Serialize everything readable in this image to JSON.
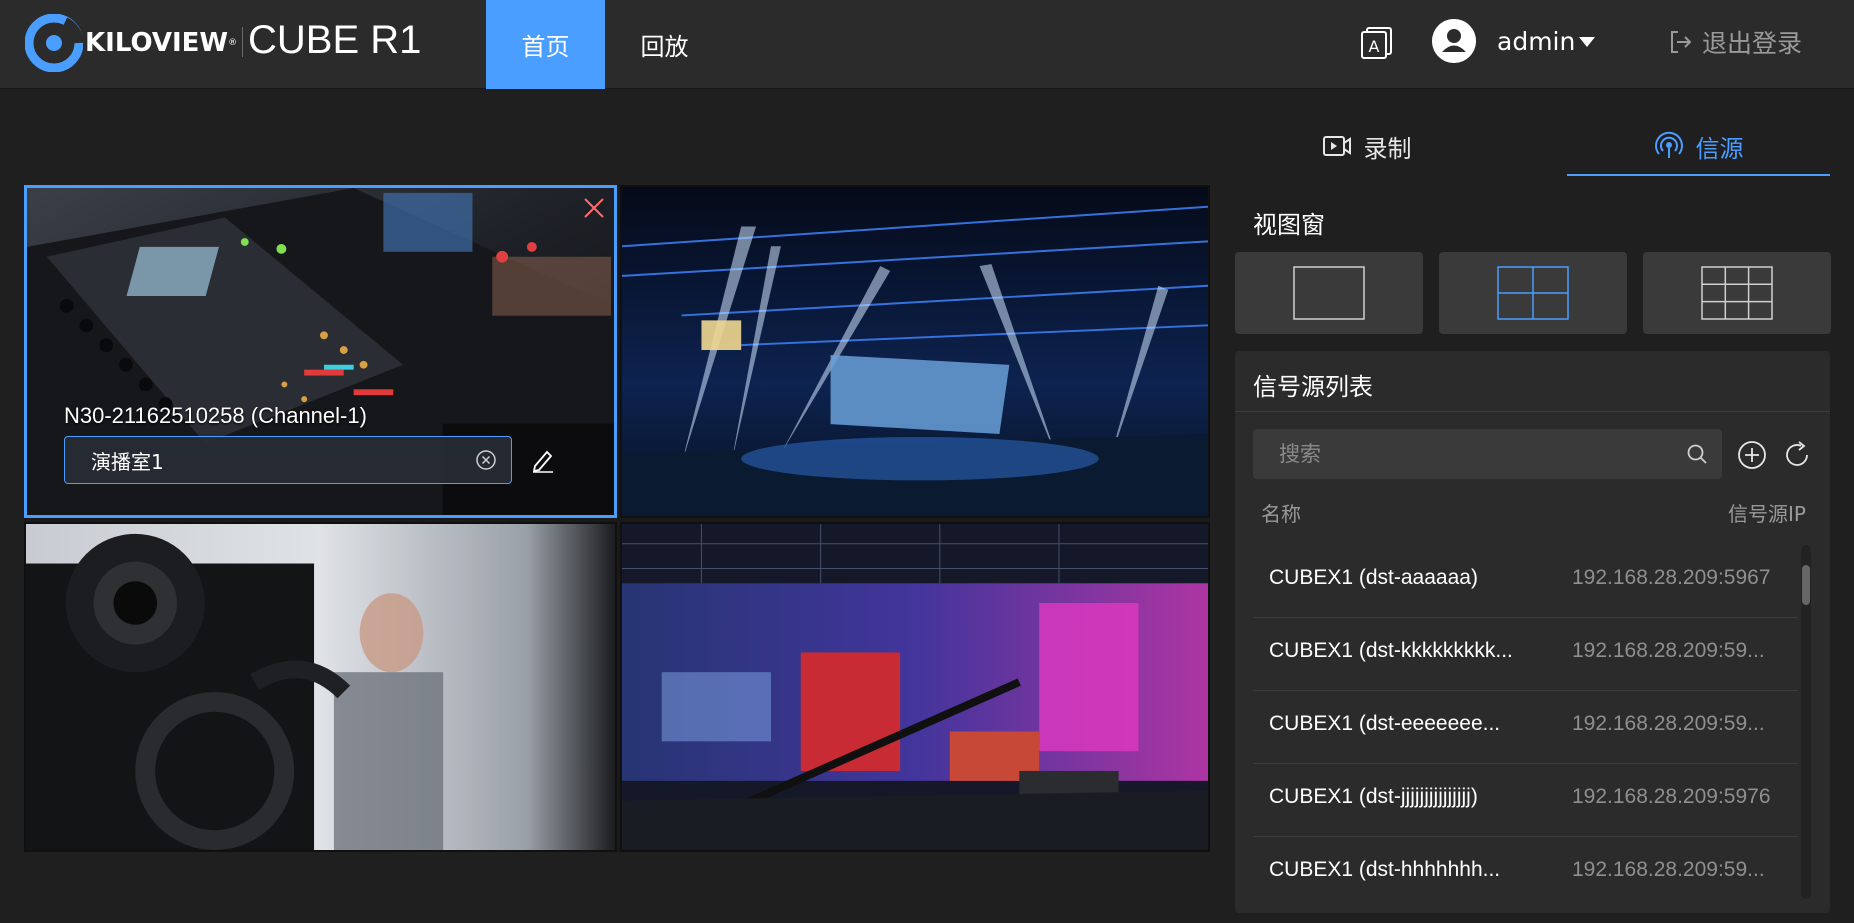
{
  "header": {
    "logo_text": "KILOVIEW",
    "logo_reg": "®",
    "product_name": "CUBE R1",
    "nav": [
      {
        "label": "首页",
        "active": true
      },
      {
        "label": "回放",
        "active": false
      }
    ],
    "language_icon": "A",
    "user": {
      "name": "admin"
    },
    "logout_label": "退出登录"
  },
  "colors": {
    "accent": "#4a9eff",
    "topbar": "#2b2b2b",
    "background": "#1f1f1f",
    "panel": "#2b2b2b"
  },
  "video_grid": {
    "layout": "2x2",
    "cells": [
      {
        "selected": true,
        "channel_label": "N30-21162510258 (Channel-1)",
        "name_value": "演播室1"
      },
      {
        "selected": false
      },
      {
        "selected": false
      },
      {
        "selected": false
      }
    ]
  },
  "right_panel": {
    "tabs": [
      {
        "label": "录制",
        "icon": "video-record-icon",
        "active": false
      },
      {
        "label": "信源",
        "icon": "signal-source-icon",
        "active": true
      }
    ],
    "view_window_title": "视图窗",
    "layouts": [
      {
        "name": "1x1",
        "active": false
      },
      {
        "name": "2x2",
        "active": true
      },
      {
        "name": "3x3",
        "active": false
      }
    ],
    "source_list": {
      "title": "信号源列表",
      "search_placeholder": "搜索",
      "columns": {
        "name": "名称",
        "ip": "信号源IP"
      },
      "rows": [
        {
          "name": "CUBEX1 (dst-aaaaaa)",
          "ip": "192.168.28.209:5967"
        },
        {
          "name": "CUBEX1 (dst-kkkkkkkkk...",
          "ip": "192.168.28.209:59..."
        },
        {
          "name": "CUBEX1 (dst-eeeeeee...",
          "ip": "192.168.28.209:59..."
        },
        {
          "name": "CUBEX1 (dst-jjjjjjjjjjjjjjj)",
          "ip": "192.168.28.209:5976"
        },
        {
          "name": "CUBEX1 (dst-hhhhhhh...",
          "ip": "192.168.28.209:59..."
        }
      ]
    }
  }
}
